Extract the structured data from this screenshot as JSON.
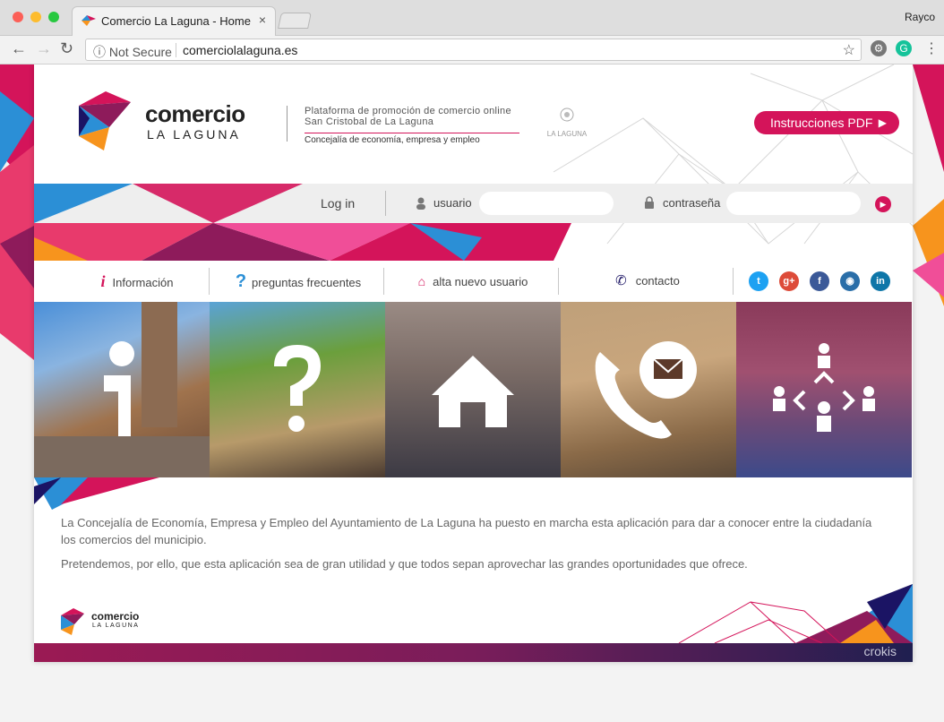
{
  "browser": {
    "tab_title": "Comercio La Laguna - Home",
    "tab_close": "×",
    "user": "Rayco",
    "security_label": "Not Secure",
    "url": "comerciolalaguna.es"
  },
  "header": {
    "logo_word1": "comercio",
    "logo_word2": "LA LAGUNA",
    "tagline1": "Plataforma de promoción de comercio online",
    "tagline2": "San Cristobal de La Laguna",
    "tagline3": "Concejalía de economía, empresa y empleo",
    "seal_text": "LA LAGUNA",
    "pdf_button": "Instrucciones PDF"
  },
  "login": {
    "label": "Log in",
    "user_label": "usuario",
    "password_label": "contraseña",
    "user_value": "",
    "password_value": ""
  },
  "menu": {
    "items": [
      {
        "label": "Información"
      },
      {
        "label": "preguntas frecuentes"
      },
      {
        "label": "alta nuevo usuario"
      },
      {
        "label": "contacto"
      }
    ],
    "social": [
      "twitter-icon",
      "google-plus-icon",
      "facebook-icon",
      "instagram-icon",
      "linkedin-icon"
    ]
  },
  "tiles": [
    "information-icon",
    "question-icon",
    "house-icon",
    "phone-mail-icon",
    "network-people-icon"
  ],
  "content": {
    "para1": "La Concejalía de Economía, Empresa y Empleo del Ayuntamiento de La Laguna ha puesto en marcha esta aplicación para dar a conocer entre la ciudadanía los comercios del municipio.",
    "para2": "Pretendemos, por ello, que esta aplicación sea de gran utilidad y que todos sepan aprovechar las grandes oportunidades que ofrece."
  },
  "footer": {
    "logo_word1": "comercio",
    "logo_word2": "LA LAGUNA",
    "credit": "crokis"
  },
  "colors": {
    "brand_pink": "#d4145a",
    "brand_blue": "#2b8fd6",
    "footer_dark": "#1f1f50"
  }
}
